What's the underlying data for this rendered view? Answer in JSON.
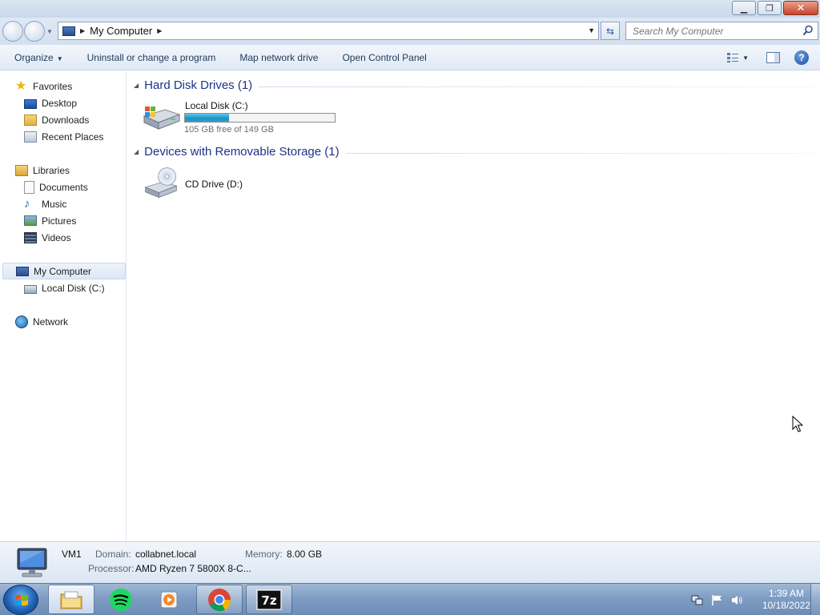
{
  "window": {
    "minimize_icon": "minimize-icon",
    "restore_icon": "restore-icon",
    "close_icon": "close-icon"
  },
  "address": {
    "location": "My Computer",
    "search_placeholder": "Search My Computer"
  },
  "toolbar": {
    "organize": "Organize",
    "uninstall": "Uninstall or change a program",
    "map_drive": "Map network drive",
    "control_panel": "Open Control Panel"
  },
  "nav": {
    "favorites": "Favorites",
    "desktop": "Desktop",
    "downloads": "Downloads",
    "recent": "Recent Places",
    "libraries": "Libraries",
    "documents": "Documents",
    "music": "Music",
    "pictures": "Pictures",
    "videos": "Videos",
    "computer": "My Computer",
    "local_disk": "Local Disk (C:)",
    "network": "Network"
  },
  "content": {
    "hdd_group": "Hard Disk Drives (1)",
    "removable_group": "Devices with Removable Storage (1)",
    "drive_c": {
      "name": "Local Disk (C:)",
      "free_text": "105 GB free of 149 GB",
      "used_fraction": 0.295
    },
    "drive_d": {
      "name": "CD Drive (D:)"
    }
  },
  "details": {
    "computer_name": "VM1",
    "domain_label": "Domain:",
    "domain_value": "collabnet.local",
    "memory_label": "Memory:",
    "memory_value": "8.00 GB",
    "processor_label": "Processor:",
    "processor_value": "AMD Ryzen 7 5800X 8-C..."
  },
  "taskbar": {
    "time": "1:39 AM",
    "date": "10/18/2022",
    "apps": [
      "windows-explorer",
      "spotify",
      "media-player",
      "chrome",
      "7-zip"
    ]
  },
  "colors": {
    "group_title": "#1e3287",
    "drive_bar_fill": "#27a5d4",
    "taskbar": "#7f9dc3"
  }
}
